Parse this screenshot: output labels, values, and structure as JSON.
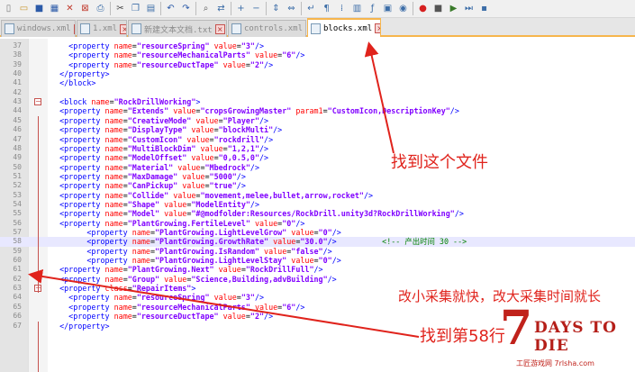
{
  "toolbar": {
    "icons": [
      "new-file-icon",
      "open-file-icon",
      "save-icon",
      "save-all-icon",
      "close-icon",
      "close-all-icon",
      "print-icon",
      "cut-icon",
      "copy-icon",
      "paste-icon",
      "undo-icon",
      "redo-icon",
      "find-icon",
      "replace-icon",
      "zoom-in-icon",
      "zoom-out-icon",
      "sync-v-icon",
      "sync-h-icon",
      "word-wrap-icon",
      "show-all-icon",
      "indent-guide-icon",
      "doc-map-icon",
      "function-list-icon",
      "folder-workspace-icon",
      "monitor-icon",
      "record-macro-icon",
      "stop-macro-icon",
      "play-macro-icon",
      "run-macro-multiple-icon",
      "save-macro-icon"
    ]
  },
  "tabs": [
    {
      "label": "windows.xml"
    },
    {
      "label": "1.xml"
    },
    {
      "label": "新建文本文档.txt"
    },
    {
      "label": "controls.xml"
    },
    {
      "label": "blocks.xml"
    }
  ],
  "lines": [
    {
      "n": "37",
      "text": "    <property name=\"resourceSpring\" value=\"3\"/>"
    },
    {
      "n": "38",
      "text": "    <property name=\"resourceMechanicalParts\" value=\"6\"/>"
    },
    {
      "n": "39",
      "text": "    <property name=\"resourceDuctTape\" value=\"2\"/>"
    },
    {
      "n": "40",
      "text": "  </property>"
    },
    {
      "n": "41",
      "text": "  </block>"
    },
    {
      "n": "42",
      "text": ""
    },
    {
      "n": "43",
      "text": "  <block name=\"RockDrillWorking\">"
    },
    {
      "n": "44",
      "text": "  <property name=\"Extends\" value=\"cropsGrowingMaster\" param1=\"CustomIcon,DescriptionKey\"/>"
    },
    {
      "n": "45",
      "text": "  <property name=\"CreativeMode\" value=\"Player\"/>"
    },
    {
      "n": "46",
      "text": "  <property name=\"DisplayType\" value=\"blockMulti\"/>"
    },
    {
      "n": "47",
      "text": "  <property name=\"CustomIcon\" value=\"rockdrill\"/>"
    },
    {
      "n": "48",
      "text": "  <property name=\"MultiBlockDim\" value=\"1,2,1\"/>"
    },
    {
      "n": "49",
      "text": "  <property name=\"ModelOffset\" value=\"0,0.5,0\"/>"
    },
    {
      "n": "50",
      "text": "  <property name=\"Material\" value=\"Mbedrock\"/>"
    },
    {
      "n": "51",
      "text": "  <property name=\"MaxDamage\" value=\"5000\"/>"
    },
    {
      "n": "52",
      "text": "  <property name=\"CanPickup\" value=\"true\"/>"
    },
    {
      "n": "53",
      "text": "  <property name=\"Collide\" value=\"movement,melee,bullet,arrow,rocket\"/>"
    },
    {
      "n": "54",
      "text": "  <property name=\"Shape\" value=\"ModelEntity\"/>"
    },
    {
      "n": "55",
      "text": "  <property name=\"Model\" value=\"#@modfolder:Resources/RockDrill.unity3d?RockDrillWorking\"/>"
    },
    {
      "n": "56",
      "text": "  <property name=\"PlantGrowing.FertileLevel\" value=\"0\"/>"
    },
    {
      "n": "57",
      "text": "        <property name=\"PlantGrowing.LightLevelGrow\" value=\"0\"/>"
    },
    {
      "n": "58",
      "text": "        <property name=\"PlantGrowing.GrowthRate\" value=\"30.0\"/>          <!-- 产出时间 30 -->"
    },
    {
      "n": "59",
      "text": "        <property name=\"PlantGrowing.IsRandom\" value=\"false\"/>"
    },
    {
      "n": "60",
      "text": "        <property name=\"PlantGrowing.LightLevelStay\" value=\"0\"/>"
    },
    {
      "n": "61",
      "text": "  <property name=\"PlantGrowing.Next\" value=\"RockDrillFull\"/>"
    },
    {
      "n": "62",
      "text": "  <property name=\"Group\" value=\"Science,Building,advBuilding\"/>"
    },
    {
      "n": "63",
      "text": "  <property class=\"RepairItems\">"
    },
    {
      "n": "64",
      "text": "    <property name=\"resourceSpring\" value=\"3\"/>"
    },
    {
      "n": "65",
      "text": "    <property name=\"resourceMechanicalParts\" value=\"6\"/>"
    },
    {
      "n": "66",
      "text": "    <property name=\"resourceDuctTape\" value=\"2\"/>"
    },
    {
      "n": "67",
      "text": "  </property>"
    }
  ],
  "annotations": {
    "find_file": "找到这个文件",
    "explain": "改小采集就快，改大采集时间就长",
    "find_line": "找到第58行"
  },
  "logo": {
    "number": "7",
    "title": "DAYS TO DIE",
    "site": "工匠游戏网 7rlsha.com"
  },
  "colors": {
    "arrow": "#e0231c",
    "tab_accent": "#f6b54c",
    "tag": "#0000ff",
    "attr": "#ff0000",
    "value": "#8000ff",
    "comment": "#008000"
  }
}
